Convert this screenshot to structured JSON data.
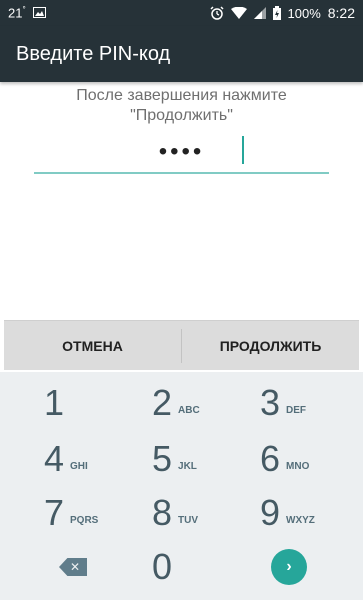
{
  "status_bar": {
    "temperature": "21",
    "temperature_unit": "°",
    "battery_percent": "100%",
    "time": "8:22",
    "icons": [
      "image-icon",
      "alarm-icon",
      "wifi-icon",
      "signal-icon",
      "battery-charging-icon"
    ]
  },
  "header": {
    "title": "Введите PIN-код"
  },
  "pin_entry": {
    "prompt_line1": "После завершения нажмите",
    "prompt_line2": "\"Продолжить\"",
    "masked_value": "••••"
  },
  "actions": {
    "cancel_label": "ОТМЕНА",
    "continue_label": "ПРОДОЛЖИТЬ"
  },
  "keypad": {
    "keys": [
      {
        "num": "1",
        "letters": ""
      },
      {
        "num": "2",
        "letters": "ABC"
      },
      {
        "num": "3",
        "letters": "DEF"
      },
      {
        "num": "4",
        "letters": "GHI"
      },
      {
        "num": "5",
        "letters": "JKL"
      },
      {
        "num": "6",
        "letters": "MNO"
      },
      {
        "num": "7",
        "letters": "PQRS"
      },
      {
        "num": "8",
        "letters": "TUV"
      },
      {
        "num": "9",
        "letters": "WXYZ"
      },
      {
        "num": "0",
        "letters": ""
      }
    ],
    "delete_icon": "backspace-icon",
    "go_icon": "chevron-right-icon"
  },
  "colors": {
    "toolbar": "#263238",
    "accent": "#26a69a",
    "keypad_bg": "#eceff1",
    "action_bar_bg": "#dcdcdc"
  }
}
